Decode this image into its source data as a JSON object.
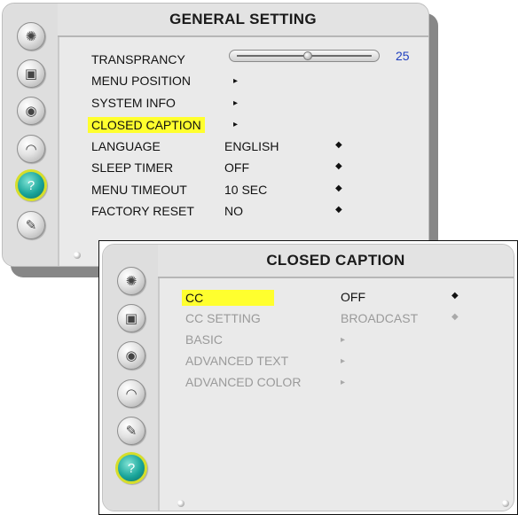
{
  "general": {
    "title": "GENERAL SETTING",
    "transparency": {
      "label": "TRANSPRANCY",
      "value": "25",
      "level": 0.25
    },
    "items": [
      {
        "label": "MENU POSITION",
        "value": "",
        "arrow": "▸"
      },
      {
        "label": "SYSTEM INFO",
        "value": "",
        "arrow": "▸"
      },
      {
        "label": "CLOSED CAPTION",
        "value": "",
        "arrow": "▸"
      },
      {
        "label": "LANGUAGE",
        "value": "ENGLISH",
        "arrow": "◆"
      },
      {
        "label": "SLEEP TIMER",
        "value": "OFF",
        "arrow": "◆"
      },
      {
        "label": "MENU TIMEOUT",
        "value": "10 SEC",
        "arrow": "◆"
      },
      {
        "label": "FACTORY RESET",
        "value": "NO",
        "arrow": "◆"
      }
    ],
    "sidebar_icons": [
      "brightness-icon",
      "screen-icon",
      "audio-speaker-icon",
      "tv-icon",
      "general-setting-icon",
      "lock-icon"
    ]
  },
  "closed_caption": {
    "title": "CLOSED CAPTION",
    "items": [
      {
        "label": "CC",
        "value": "OFF",
        "arrow": "◆"
      },
      {
        "label": "CC SETTING",
        "value": "BROADCAST",
        "arrow": "◆"
      },
      {
        "label": "BASIC",
        "value": "",
        "arrow": "▸"
      },
      {
        "label": "ADVANCED TEXT",
        "value": "",
        "arrow": "▸"
      },
      {
        "label": "ADVANCED COLOR",
        "value": "",
        "arrow": "▸"
      }
    ],
    "sidebar_icons": [
      "brightness-icon",
      "screen-icon",
      "audio-speaker-icon",
      "tv-icon",
      "lock-icon",
      "general-setting-icon"
    ]
  },
  "colors": {
    "highlight": "#ffff2e",
    "accent_blue": "#1f3fbf",
    "active_icon": "#1aa59a",
    "active_ring": "#d6de2a"
  }
}
